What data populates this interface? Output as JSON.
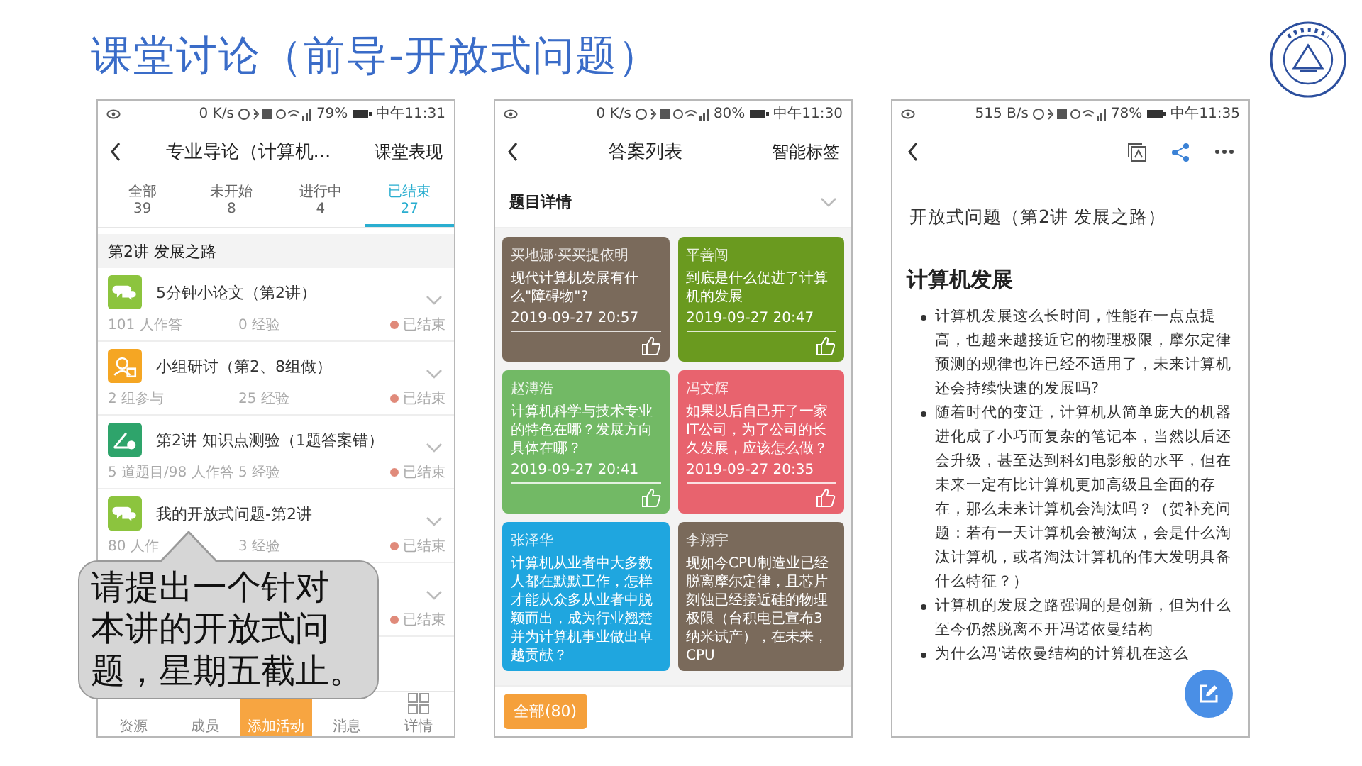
{
  "slide_title": "课堂讨论（前导-开放式问题）",
  "activity_screen": {
    "status_bar": {
      "speed": "0 K/s",
      "battery": "79%",
      "time": "中午11:31"
    },
    "header": {
      "title": "专业导论（计算机...",
      "action": "课堂表现"
    },
    "tabs": [
      {
        "label": "全部",
        "count": "39",
        "selected": false
      },
      {
        "label": "未开始",
        "count": "8",
        "selected": false
      },
      {
        "label": "进行中",
        "count": "4",
        "selected": false
      },
      {
        "label": "已结束",
        "count": "27",
        "selected": true
      }
    ],
    "section": "第2讲 发展之路",
    "activities": [
      {
        "kind": "essay",
        "title": "5分钟小论文（第2讲）",
        "participants": "101 人作答",
        "points": "0 经验",
        "status": "已结束"
      },
      {
        "kind": "group",
        "title": "小组研讨（第2、8组做）",
        "participants": "2 组参与",
        "points": "25 经验",
        "status": "已结束"
      },
      {
        "kind": "quiz",
        "title": "第2讲 知识点测验（1题答案错）",
        "participants": "5 道题目/98 人作答",
        "points": "5 经验",
        "status": "已结束"
      },
      {
        "kind": "discussion",
        "title": "我的开放式问题-第2讲",
        "participants": "80 人作",
        "points": "3 经验",
        "status": "已结束"
      },
      {
        "status": "已结束"
      }
    ],
    "bottom_nav": [
      {
        "label": "资源",
        "kind": "plain"
      },
      {
        "label": "成员",
        "kind": "plain"
      },
      {
        "label": "添加活动",
        "kind": "primary"
      },
      {
        "label": "消息",
        "kind": "plain"
      },
      {
        "label": "详情",
        "kind": "icon"
      }
    ],
    "callout": [
      "请提出一个针对",
      "本讲的开放式问",
      "题，星期五截止。"
    ]
  },
  "answer_screen": {
    "status_bar": {
      "speed": "0 K/s",
      "battery": "80%",
      "time": "中午11:30"
    },
    "header": {
      "title": "答案列表",
      "action": "智能标签"
    },
    "detail_label": "题目详情",
    "answers": [
      {
        "author": "买地娜·买买提依明",
        "text": "现代计算机发展有什么\"障碍物\"?",
        "time": "2019-09-27 20:57",
        "color": "#7a6a5b"
      },
      {
        "author": "平善闯",
        "text": "到底是什么促进了计算机的发展",
        "time": "2019-09-27 20:47",
        "color": "#6a9a1f"
      },
      {
        "author": "赵溥浩",
        "text": "计算机科学与技术专业的特色在哪？发展方向具体在哪？",
        "time": "2019-09-27 20:41",
        "color": "#72b965"
      },
      {
        "author": "冯文辉",
        "text": "如果以后自己开了一家IT公司，为了公司的长久发展，应该怎么做？",
        "time": "2019-09-27 20:35",
        "color": "#e8636e"
      },
      {
        "author": "张泽华",
        "text": "计算机从业者中大多数人都在默默工作，怎样才能从众多从业者中脱颖而出，成为行业翘楚并为计算机事业做出卓越贡献？",
        "color": "#1fa6df"
      },
      {
        "author": "李翔宇",
        "text": "现如今CPU制造业已经脱离摩尔定律，且芯片刻蚀已经接近硅的物理极限（台积电已宣布3纳米试产），在未来，CPU",
        "color": "#7a6a5b"
      }
    ],
    "filter_button": "全部(80)"
  },
  "article_screen": {
    "status_bar": {
      "speed": "515 B/s",
      "battery": "78%",
      "time": "中午11:35"
    },
    "title": "开放式问题（第2讲 发展之路）",
    "heading": "计算机发展",
    "bullets": [
      "计算机发展这么长时间，性能在一点点提高，也越来越接近它的物理极限，摩尔定律预测的规律也许已经不适用了，未来计算机还会持续快速的发展吗?",
      "随着时代的变迁，计算机从简单庞大的机器进化成了小巧而复杂的笔记本，当然以后还会升级，甚至达到科幻电影般的水平，但在未来一定有比计算机更加高级且全面的存在，那么未来计算机会淘汰吗？（贺补充问题：若有一天计算机会被淘汰，会是什么淘汰计算机，或者淘汰计算机的伟大发明具备什么特征？）",
      "计算机的发展之路强调的是创新，但为什么至今仍然脱离不开冯诺依曼结构",
      "为什么冯'诺依曼结构的计算机在这么"
    ]
  }
}
